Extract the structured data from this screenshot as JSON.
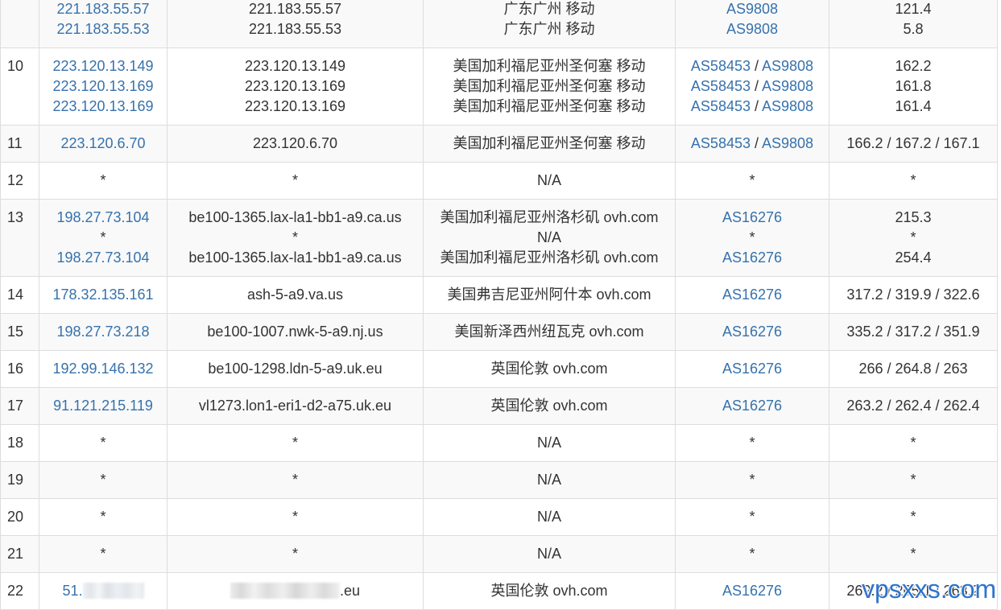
{
  "table": {
    "as_separator": " / ",
    "rows": [
      {
        "ip": [
          "221.183.55.57",
          "221.183.55.53"
        ],
        "host": [
          "221.183.55.57",
          "221.183.55.53"
        ],
        "location": [
          "广东广州 移动",
          "广东广州 移动"
        ],
        "as": [
          [
            "AS9808"
          ],
          [
            "AS9808"
          ]
        ],
        "latency": [
          "121.4",
          "5.8"
        ]
      },
      {
        "hop": "10",
        "ip": [
          "223.120.13.149",
          "223.120.13.169",
          "223.120.13.169"
        ],
        "host": [
          "223.120.13.149",
          "223.120.13.169",
          "223.120.13.169"
        ],
        "location": [
          "美国加利福尼亚州圣何塞 移动",
          "美国加利福尼亚州圣何塞 移动",
          "美国加利福尼亚州圣何塞 移动"
        ],
        "as": [
          [
            "AS58453",
            "AS9808"
          ],
          [
            "AS58453",
            "AS9808"
          ],
          [
            "AS58453",
            "AS9808"
          ]
        ],
        "latency": [
          "162.2",
          "161.8",
          "161.4"
        ]
      },
      {
        "hop": "11",
        "ip": [
          "223.120.6.70"
        ],
        "host": [
          "223.120.6.70"
        ],
        "location": [
          "美国加利福尼亚州圣何塞 移动"
        ],
        "as": [
          [
            "AS58453",
            "AS9808"
          ]
        ],
        "latency": [
          "166.2 / 167.2 / 167.1"
        ]
      },
      {
        "hop": "12",
        "ip": [
          "*"
        ],
        "host": [
          "*"
        ],
        "location": [
          "N/A"
        ],
        "as": [
          [
            "*"
          ]
        ],
        "latency": [
          "*"
        ]
      },
      {
        "hop": "13",
        "ip": [
          "198.27.73.104",
          "*",
          "198.27.73.104"
        ],
        "host": [
          "be100-1365.lax-la1-bb1-a9.ca.us",
          "*",
          "be100-1365.lax-la1-bb1-a9.ca.us"
        ],
        "location": [
          "美国加利福尼亚州洛杉矶 ovh.com",
          "N/A",
          "美国加利福尼亚州洛杉矶 ovh.com"
        ],
        "as": [
          [
            "AS16276"
          ],
          [
            "*"
          ],
          [
            "AS16276"
          ]
        ],
        "latency": [
          "215.3",
          "*",
          "254.4"
        ]
      },
      {
        "hop": "14",
        "ip": [
          "178.32.135.161"
        ],
        "host": [
          "ash-5-a9.va.us"
        ],
        "location": [
          "美国弗吉尼亚州阿什本 ovh.com"
        ],
        "as": [
          [
            "AS16276"
          ]
        ],
        "latency": [
          "317.2 / 319.9 / 322.6"
        ]
      },
      {
        "hop": "15",
        "ip": [
          "198.27.73.218"
        ],
        "host": [
          "be100-1007.nwk-5-a9.nj.us"
        ],
        "location": [
          "美国新泽西州纽瓦克 ovh.com"
        ],
        "as": [
          [
            "AS16276"
          ]
        ],
        "latency": [
          "335.2 / 317.2 / 351.9"
        ]
      },
      {
        "hop": "16",
        "ip": [
          "192.99.146.132"
        ],
        "host": [
          "be100-1298.ldn-5-a9.uk.eu"
        ],
        "location": [
          "英国伦敦 ovh.com"
        ],
        "as": [
          [
            "AS16276"
          ]
        ],
        "latency": [
          "266 / 264.8 / 263"
        ]
      },
      {
        "hop": "17",
        "ip": [
          "91.121.215.119"
        ],
        "host": [
          "vl1273.lon1-eri1-d2-a75.uk.eu"
        ],
        "location": [
          "英国伦敦 ovh.com"
        ],
        "as": [
          [
            "AS16276"
          ]
        ],
        "latency": [
          "263.2 / 262.4 / 262.4"
        ]
      },
      {
        "hop": "18",
        "ip": [
          "*"
        ],
        "host": [
          "*"
        ],
        "location": [
          "N/A"
        ],
        "as": [
          [
            "*"
          ]
        ],
        "latency": [
          "*"
        ]
      },
      {
        "hop": "19",
        "ip": [
          "*"
        ],
        "host": [
          "*"
        ],
        "location": [
          "N/A"
        ],
        "as": [
          [
            "*"
          ]
        ],
        "latency": [
          "*"
        ]
      },
      {
        "hop": "20",
        "ip": [
          "*"
        ],
        "host": [
          "*"
        ],
        "location": [
          "N/A"
        ],
        "as": [
          [
            "*"
          ]
        ],
        "latency": [
          "*"
        ]
      },
      {
        "hop": "21",
        "ip": [
          "*"
        ],
        "host": [
          "*"
        ],
        "location": [
          "N/A"
        ],
        "as": [
          [
            "*"
          ]
        ],
        "latency": [
          "*"
        ]
      },
      {
        "hop": "22",
        "ip": [
          "51."
        ],
        "host": [
          ".eu"
        ],
        "location": [
          "英国伦敦 ovh.com"
        ],
        "as": [
          [
            "AS16276"
          ]
        ],
        "latency": [
          "269.2 / 265.1 / 263.2"
        ]
      }
    ]
  },
  "watermark": "vpsxxs.com",
  "colors": {
    "link": "#3672ad",
    "text": "#333333",
    "stripe": "#f9f9f9",
    "border": "#dddddd",
    "watermark": "#2f74cc"
  }
}
